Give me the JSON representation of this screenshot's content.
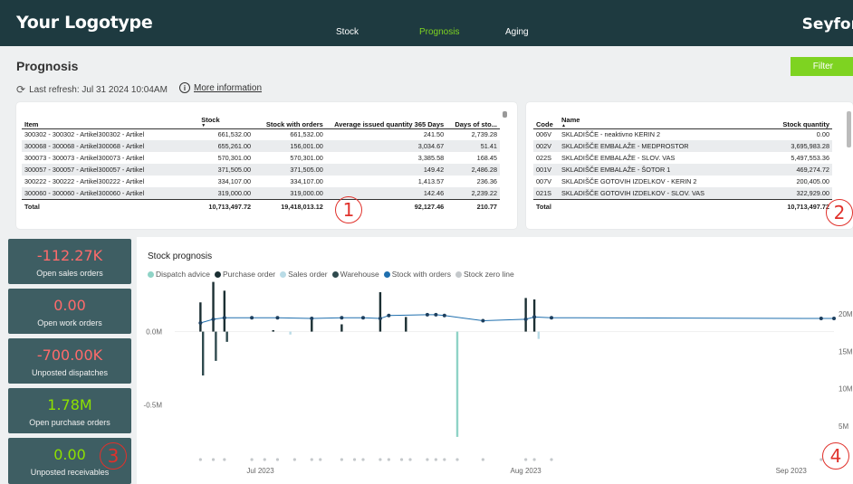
{
  "header": {
    "logo": "Your Logotype",
    "nav": [
      {
        "label": "Stock",
        "active": false
      },
      {
        "label": "Prognosis",
        "active": true
      },
      {
        "label": "Aging",
        "active": false
      }
    ],
    "brand": "Seyfor"
  },
  "page": {
    "title": "Prognosis",
    "refresh": "Last refresh: Jul 31 2024 10:04AM",
    "more_info": "More information",
    "filter_label": "Filter"
  },
  "items_table": {
    "columns": [
      "Item",
      "Stock",
      "Stock with orders",
      "Average issued quantity 365 Days",
      "Days of sto..."
    ],
    "rows": [
      [
        "300302 - 300302 - Artikel300302 - Artikel",
        "661,532.00",
        "661,532.00",
        "241.50",
        "2,739.28"
      ],
      [
        "300068 - 300068 - Artikel300068 - Artikel",
        "655,261.00",
        "156,001.00",
        "3,034.67",
        "51.41"
      ],
      [
        "300073 - 300073 - Artikel300073 - Artikel",
        "570,301.00",
        "570,301.00",
        "3,385.58",
        "168.45"
      ],
      [
        "300057 - 300057 - Artikel300057 - Artikel",
        "371,505.00",
        "371,505.00",
        "149.42",
        "2,486.28"
      ],
      [
        "300222 - 300222 - Artikel300222 - Artikel",
        "334,107.00",
        "334,107.00",
        "1,413.57",
        "236.36"
      ],
      [
        "300060 - 300060 - Artikel300060 - Artikel",
        "319,000.00",
        "319,000.00",
        "142.46",
        "2,239.22"
      ]
    ],
    "total": [
      "Total",
      "10,713,497.72",
      "19,418,013.12",
      "92,127.46",
      "210.77"
    ]
  },
  "warehouse_table": {
    "columns": [
      "Code",
      "Name",
      "Stock quantity"
    ],
    "rows": [
      [
        "006V",
        "SKLADIŠČE - neaktivno KERIN 2",
        "0.00"
      ],
      [
        "002V",
        "SKLADIŠČE EMBALAŽE - MEDPROSTOR",
        "3,695,983.28"
      ],
      [
        "022S",
        "SKLADIŠČE EMBALAŽE - SLOV. VAS",
        "5,497,553.36"
      ],
      [
        "001V",
        "SKLADIŠČE EMBALAŽE - ŠOTOR 1",
        "469,274.72"
      ],
      [
        "007V",
        "SKLADIŠČE GOTOVIH IZDELKOV - KERIN 2",
        "200,405.00"
      ],
      [
        "021S",
        "SKLADIŠČE GOTOVIH IZDELKOV - SLOV. VAS",
        "322,929.00"
      ]
    ],
    "total": [
      "Total",
      "",
      "10,713,497.72"
    ]
  },
  "kpis": [
    {
      "value": "-112.27K",
      "label": "Open sales orders",
      "color": "#ff6b6b"
    },
    {
      "value": "0.00",
      "label": "Open work orders",
      "color": "#ff6b6b"
    },
    {
      "value": "-700.00K",
      "label": "Unposted dispatches",
      "color": "#ff6b6b"
    },
    {
      "value": "1.78M",
      "label": "Open purchase orders",
      "color": "#8ee000"
    },
    {
      "value": "0.00",
      "label": "Unposted receivables",
      "color": "#8ee000"
    }
  ],
  "callouts": [
    "1",
    "2",
    "3",
    "4"
  ],
  "chart_data": {
    "type": "bar",
    "title": "Stock prognosis",
    "legend": [
      {
        "name": "Dispatch advice",
        "color": "#8fd3c6"
      },
      {
        "name": "Purchase order",
        "color": "#1b2f33"
      },
      {
        "name": "Sales order",
        "color": "#b9dbe6"
      },
      {
        "name": "Warehouse",
        "color": "#2f4a4e"
      },
      {
        "name": "Stock with orders",
        "color": "#1f6fae"
      },
      {
        "name": "Stock zero line",
        "color": "#c4c8cb"
      }
    ],
    "x_ticks": [
      {
        "label": "Jul 2023",
        "day": 12
      },
      {
        "label": "Aug 2023",
        "day": 43
      },
      {
        "label": "Sep 2023",
        "day": 74
      }
    ],
    "x_range_days": [
      2,
      79
    ],
    "y_left": {
      "range": [
        -0.9,
        0.35
      ],
      "ticks": [
        {
          "label": "0.0M",
          "v": 0
        },
        {
          "label": "-0.5M",
          "v": -0.5
        }
      ]
    },
    "y_right": {
      "range": [
        0,
        24.5
      ],
      "ticks": [
        {
          "label": "20M",
          "v": 20
        },
        {
          "label": "15M",
          "v": 15
        },
        {
          "label": "10M",
          "v": 10
        },
        {
          "label": "5M",
          "v": 5
        }
      ]
    },
    "bars": [
      {
        "day": 5,
        "value": 0.2,
        "series": "Purchase order"
      },
      {
        "day": 5.3,
        "value": -0.3,
        "series": "Warehouse"
      },
      {
        "day": 6.5,
        "value": 0.34,
        "series": "Purchase order"
      },
      {
        "day": 6.8,
        "value": -0.2,
        "series": "Warehouse"
      },
      {
        "day": 7.8,
        "value": 0.28,
        "series": "Purchase order"
      },
      {
        "day": 8.1,
        "value": -0.07,
        "series": "Warehouse"
      },
      {
        "day": 13.5,
        "value": 0.01,
        "series": "Purchase order"
      },
      {
        "day": 15.5,
        "value": -0.02,
        "series": "Sales order"
      },
      {
        "day": 18,
        "value": 0.08,
        "series": "Purchase order"
      },
      {
        "day": 21.5,
        "value": 0.05,
        "series": "Purchase order"
      },
      {
        "day": 26,
        "value": 0.27,
        "series": "Purchase order"
      },
      {
        "day": 29,
        "value": 0.1,
        "series": "Purchase order"
      },
      {
        "day": 35,
        "value": -0.72,
        "series": "Dispatch advice"
      },
      {
        "day": 43,
        "value": 0.23,
        "series": "Purchase order"
      },
      {
        "day": 44,
        "value": 0.22,
        "series": "Purchase order"
      },
      {
        "day": 44.5,
        "value": -0.05,
        "series": "Sales order"
      }
    ],
    "stock_line": [
      {
        "day": 5,
        "value": 18.8
      },
      {
        "day": 6.5,
        "value": 19.3
      },
      {
        "day": 7.8,
        "value": 19.5
      },
      {
        "day": 11,
        "value": 19.5
      },
      {
        "day": 14,
        "value": 19.5
      },
      {
        "day": 18,
        "value": 19.4
      },
      {
        "day": 21.5,
        "value": 19.5
      },
      {
        "day": 24,
        "value": 19.5
      },
      {
        "day": 26,
        "value": 19.4
      },
      {
        "day": 27,
        "value": 19.8
      },
      {
        "day": 31.5,
        "value": 19.9
      },
      {
        "day": 32.5,
        "value": 19.9
      },
      {
        "day": 33.5,
        "value": 19.8
      },
      {
        "day": 38,
        "value": 19.1
      },
      {
        "day": 43,
        "value": 19.3
      },
      {
        "day": 44,
        "value": 19.6
      },
      {
        "day": 46,
        "value": 19.5
      },
      {
        "day": 77.5,
        "value": 19.4
      },
      {
        "day": 79,
        "value": 19.4
      }
    ],
    "zero_line_days": [
      5,
      6.5,
      7.8,
      11,
      12.5,
      14,
      16,
      18,
      19,
      21.5,
      23,
      24,
      26,
      27,
      28.5,
      29.5,
      31.5,
      32.5,
      33.5,
      35,
      38,
      43,
      44,
      46,
      77.5
    ]
  }
}
